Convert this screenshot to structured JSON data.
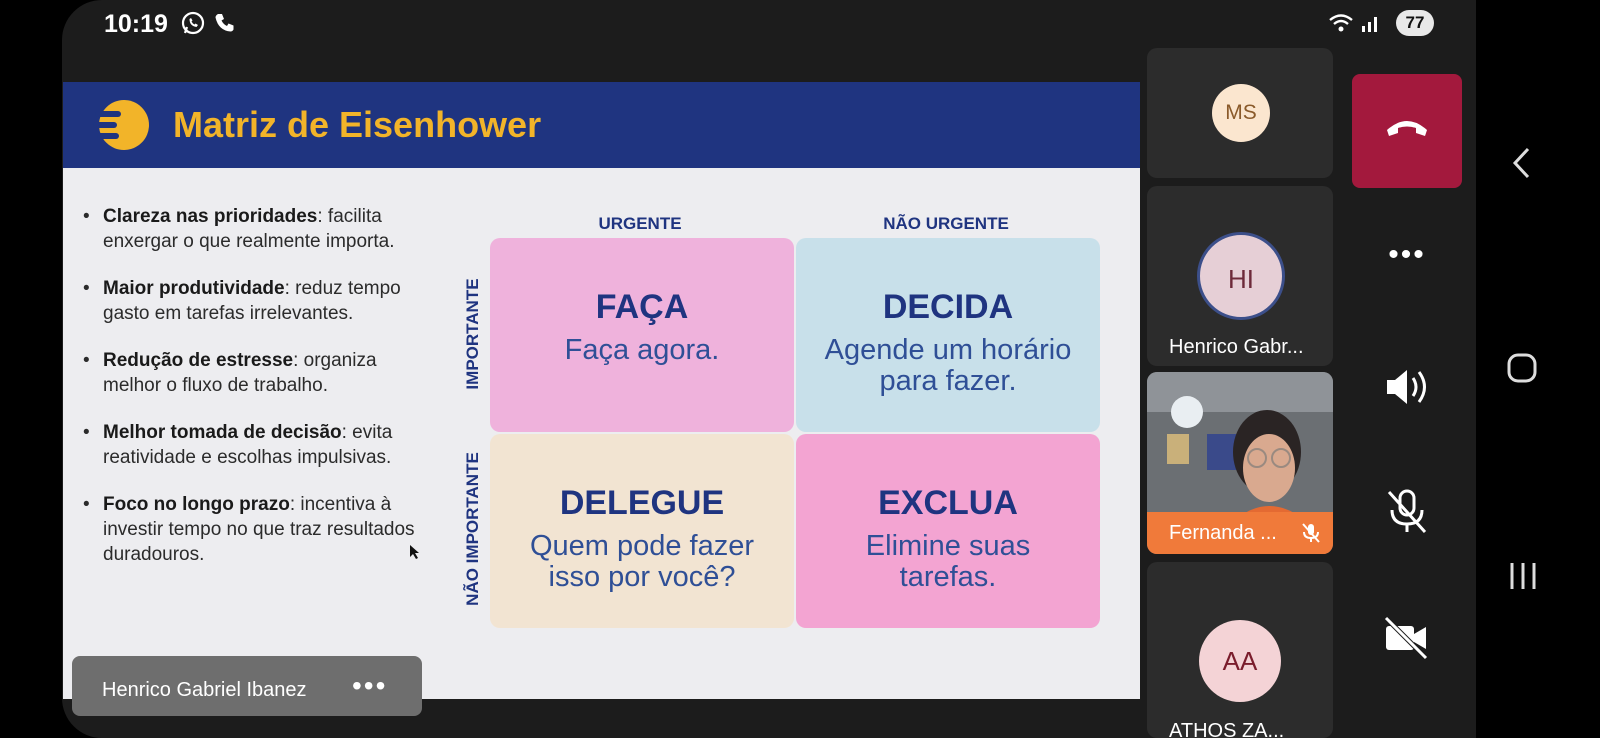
{
  "status_bar": {
    "time": "10:19",
    "battery": "77"
  },
  "slide": {
    "title": "Matriz de Eisenhower",
    "bullets": [
      {
        "bold": "Clareza nas prioridades",
        "text": ": facilita enxergar o que realmente importa."
      },
      {
        "bold": "Maior produtividade",
        "text": ": reduz tempo gasto em tarefas irrelevantes."
      },
      {
        "bold": "Redução de estresse",
        "text": ": organiza melhor o fluxo de trabalho."
      },
      {
        "bold": "Melhor tomada de decisão",
        "text": ": evita reatividade e escolhas impulsivas."
      },
      {
        "bold": "Foco no longo prazo",
        "text": ": incentiva à investir tempo no que traz resultados duradouros."
      }
    ],
    "matrix": {
      "col_urgent": "URGENTE",
      "col_not_urgent": "NÃO URGENTE",
      "row_important": "IMPORTANTE",
      "row_not_important": "NÃO IMPORTANTE",
      "do": {
        "title": "FAÇA",
        "text": "Faça agora.",
        "color": "#efb2dc"
      },
      "decide": {
        "title": "DECIDA",
        "text": "Agende um horário para fazer.",
        "color": "#c8e0ea"
      },
      "delegate": {
        "title": "DELEGUE",
        "text": "Quem pode fazer isso por você?",
        "color": "#f2e4d2"
      },
      "delete": {
        "title": "EXCLUA",
        "text": "Elimine suas tarefas.",
        "color": "#f3a4d2"
      }
    },
    "header_color": "#1f3480",
    "accent_color": "#f2b429"
  },
  "speaker": {
    "name": "Henrico Gabriel Ibanez",
    "more": "•••"
  },
  "participants": [
    {
      "initials": "MS",
      "name": ""
    },
    {
      "initials": "HI",
      "name": "Henrico Gabr..."
    },
    {
      "initials": "",
      "name": "Fernanda ..."
    },
    {
      "initials": "AA",
      "name": "ATHOS ZA..."
    }
  ],
  "controls": {
    "end_call_color": "#a3193d",
    "more": "•••",
    "icons": [
      "end-call-icon",
      "more-icon",
      "speaker-icon",
      "mic-off-icon",
      "camera-off-icon"
    ]
  },
  "nav": {
    "icons": [
      "back-icon",
      "home-icon",
      "recents-icon"
    ]
  }
}
